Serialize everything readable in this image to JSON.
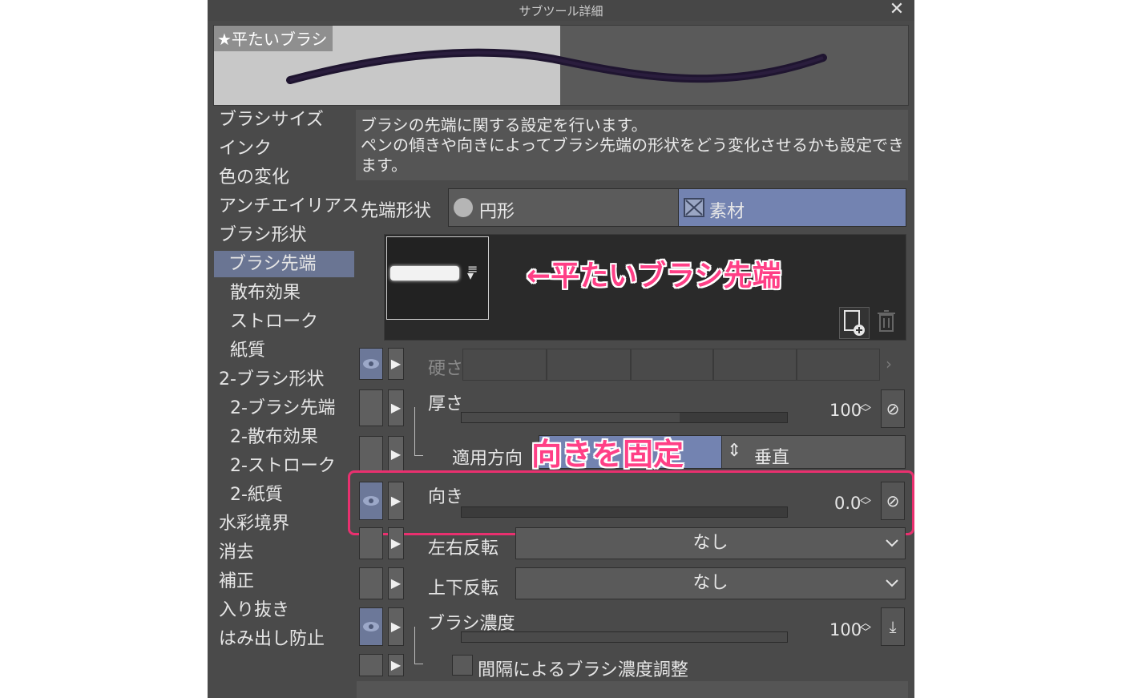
{
  "window": {
    "title": "サブツール詳細",
    "close_icon": "close-icon"
  },
  "preview": {
    "preset_name": "★平たいブラシ"
  },
  "nav": {
    "items": [
      {
        "label": "ブラシサイズ"
      },
      {
        "label": "インク"
      },
      {
        "label": "色の変化"
      },
      {
        "label": "アンチエイリアス"
      },
      {
        "label": "ブラシ形状"
      },
      {
        "label": "ブラシ先端"
      },
      {
        "label": "散布効果"
      },
      {
        "label": "ストローク"
      },
      {
        "label": "紙質"
      },
      {
        "label": "2-ブラシ形状"
      },
      {
        "label": "2-ブラシ先端"
      },
      {
        "label": "2-散布効果"
      },
      {
        "label": "2-ストローク"
      },
      {
        "label": "2-紙質"
      },
      {
        "label": "水彩境界"
      },
      {
        "label": "消去"
      },
      {
        "label": "補正"
      },
      {
        "label": "入り抜き"
      },
      {
        "label": "はみ出し防止"
      }
    ],
    "selected": "ブラシ先端"
  },
  "description": {
    "text": "ブラシの先端に関する設定を行います。\nペンの傾きや向きによってブラシ先端の形状をどう変化させるかも設定できます。"
  },
  "tip_shape": {
    "label": "先端形状",
    "options": [
      {
        "label": "円形",
        "selected": false
      },
      {
        "label": "素材",
        "selected": true
      }
    ]
  },
  "annotations": {
    "tip_note": "←平たいブラシ先端",
    "direction_note": "向きを固定",
    "highlight_color": "#e9306f"
  },
  "params": {
    "hardness": {
      "label": "硬さ",
      "disabled": true
    },
    "thickness": {
      "label": "厚さ",
      "value": "100",
      "fraction": 1.0
    },
    "apply_direction": {
      "label": "適用方向",
      "option2": "垂直"
    },
    "direction": {
      "label": "向き",
      "value": "0.0",
      "fraction": 0.0
    },
    "flip_horizontal": {
      "label": "左右反転",
      "value": "なし"
    },
    "flip_vertical": {
      "label": "上下反転",
      "value": "なし"
    },
    "brush_density": {
      "label": "ブラシ濃度",
      "value": "100",
      "fraction": 1.0
    },
    "density_by_spacing": {
      "label": "間隔によるブラシ濃度調整",
      "checked": false
    }
  },
  "colors": {
    "window_bg": "#4a4a4a",
    "selected": "#6a7593",
    "accent_pink": "#ff3f86"
  }
}
